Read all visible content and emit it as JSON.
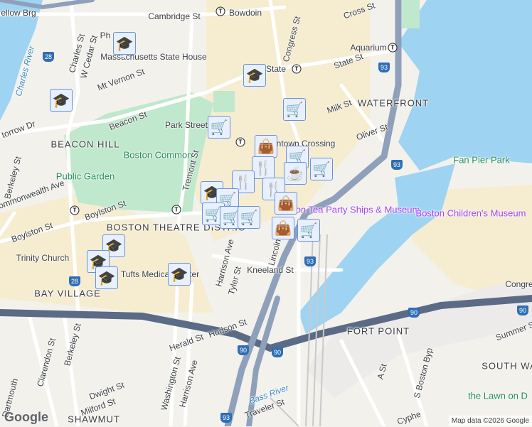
{
  "labels": {
    "bowdoin": "Bowdoin",
    "cambridge": "Cambridge St",
    "hollow": "ellow Brg",
    "charles_river": "Charles River",
    "charles_st": "Charles St",
    "wcedar": "W Cedar St",
    "ma_state_house": "Massachusetts State House",
    "mt_vernon": "Mt Vernon St",
    "beacon_st": "Beacon St",
    "beacon_hill": "BEACON HILL",
    "park_street": "Park Street",
    "boston_common": "Boston Common",
    "public_garden": "Public Garden",
    "storrow": "torrow Dr",
    "berkeley": "Berkeley St",
    "commonwealth": "Commonwealth Ave",
    "boylston_st": "Boylston St",
    "boylston_st2": "Boylston St",
    "trinity": "Trinity Church",
    "theatre": "BOSTON THEATRE DISTRICT",
    "bay_village": "BAY VILLAGE",
    "tremont": "Tremont St",
    "harrison": "Harrison Ave",
    "tyler": "Tyler St",
    "kneeland": "Kneeland St",
    "hudson": "Hudson St",
    "herald": "Herald St",
    "washington": "Washington St",
    "harrison2": "Harrison Ave",
    "berkeley2": "Berkeley St",
    "clarendon": "Clarendon St",
    "dartmouth": "Dartmouth",
    "dwight": "Dwight St",
    "milford": "Milford St",
    "shawmut": "SHAWMUT",
    "traveler": "Traveler St",
    "bass_river": "Bass River",
    "congress": "Congress St",
    "cross": "Cross St",
    "aquarium": "Aquarium",
    "state": "State",
    "state_st": "State St",
    "milk": "Milk St",
    "waterfront": "WATERFRONT",
    "oliver": "Oliver St",
    "downtown": "Downtown Crossing",
    "fan_pier": "Fan Pier Park",
    "tea_party": "Boston Tea Party Ships & Museum",
    "children": "Boston Children's Museum",
    "fort_point": "FORT POINT",
    "south_water": "SOUTH WATER",
    "summer": "Summer S",
    "congress2": "Congre",
    "a_st": "A St",
    "sbyp": "S Boston Byp",
    "lawn": "the Lawn on D",
    "cypher": "Cyphe",
    "lincoln": "Lincoln St",
    "tufts": "Tufts Medical Center",
    "ph": "Ph"
  },
  "shields": {
    "i93": "93",
    "i90": "90",
    "r28": "28"
  },
  "markers": [
    "school",
    "school",
    "school",
    "shopping-cart",
    "shopping-cart",
    "shopping-bag",
    "restaurant",
    "shopping-cart",
    "shopping-cart",
    "coffee",
    "restaurant",
    "restaurant",
    "shopping-bag",
    "school",
    "shopping-cart",
    "shopping-cart",
    "shopping-cart",
    "shopping-cart",
    "shopping-bag",
    "shopping-cart",
    "school",
    "school",
    "school",
    "school"
  ],
  "icons": {
    "school": "🎓",
    "shopping-cart": "🛒",
    "shopping-bag": "👜",
    "restaurant": "🍴",
    "coffee": "☕"
  },
  "google_logo": "Google",
  "attribution": "Map data ©2026 Google",
  "colors": {
    "water": "#9fd3f2",
    "park": "#bfe8cd",
    "highway": "#5b6b86",
    "marker_bg": "#e8f0fe",
    "marker_border": "#6a93d8",
    "marker_icon": "#0d3c61"
  }
}
